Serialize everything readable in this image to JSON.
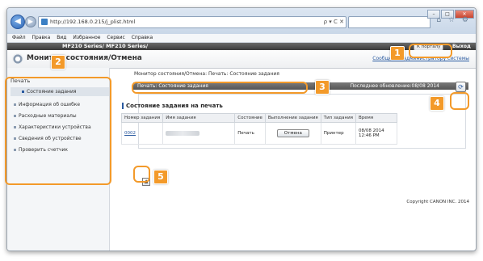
{
  "browser": {
    "url": "http://192.168.0.215/j_plist.html",
    "addr_icons": "ρ ▾ C ✕",
    "window_buttons": [
      "–",
      "□",
      "✕"
    ],
    "tool_icons": "⌂ ☆ ⚙",
    "menu": [
      "Файл",
      "Правка",
      "Вид",
      "Избранное",
      "Сервис",
      "Справка"
    ]
  },
  "header": {
    "model": "MF210 Series/ MF210 Series/",
    "portal_label": "К порталу",
    "logout_label": "Выход",
    "page_title": "Монитор состояния/Отмена",
    "sys_link": "Сообщение администратору системы"
  },
  "sidebar": {
    "heading": "Печать",
    "items": [
      {
        "label": "Состояние задания"
      },
      {
        "label": "Информация об ошибке"
      },
      {
        "label": "Расходные материалы"
      },
      {
        "label": "Характеристики устройства"
      },
      {
        "label": "Сведения об устройстве"
      },
      {
        "label": "Проверить счетчик"
      }
    ]
  },
  "main": {
    "breadcrumb": "Монитор состояния/Отмена: Печать: Состояние задания",
    "section_title": "Печать: Состояние задания",
    "updated": "Последнее обновление:08/08 2014",
    "refresh_icon": "⟳",
    "table_title": "Состояние задания на печать",
    "columns": [
      "Номер задания",
      "Имя задания",
      "Состояние",
      "Выполнение задания",
      "Тип задания",
      "Время"
    ],
    "row": {
      "job_no": "0002",
      "state": "Печать",
      "action": "Отмена",
      "type": "Принтер",
      "time_date": "08/08 2014",
      "time_clock": "12:46 PM"
    },
    "top_icon": "▲",
    "copyright": "Copyright CANON INC. 2014"
  },
  "callouts": [
    "1",
    "2",
    "3",
    "4",
    "5"
  ],
  "colors": {
    "accent": "#f39a2a",
    "link": "#2a5aa0"
  }
}
